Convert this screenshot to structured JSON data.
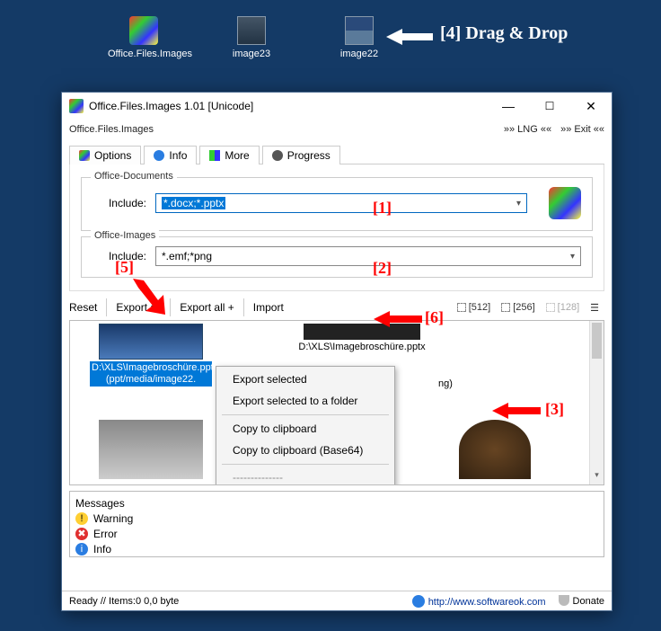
{
  "desktop": {
    "icons": [
      {
        "label": "Office.Files.Images"
      },
      {
        "label": "image23"
      },
      {
        "label": "image22"
      }
    ]
  },
  "annotations": {
    "dragdrop": "[4] Drag & Drop",
    "n1": "[1]",
    "n2": "[2]",
    "n3": "[3]",
    "n5": "[5]",
    "n6": "[6]"
  },
  "window": {
    "title": "Office.Files.Images 1.01 [Unicode]",
    "menubar": {
      "left": "Office.Files.Images",
      "lng": "»» LNG ««",
      "exit": "»» Exit ««"
    },
    "tabs": {
      "options": "Options",
      "info": "Info",
      "more": "More",
      "progress": "Progress"
    },
    "group_docs": {
      "legend": "Office-Documents",
      "label": "Include:",
      "value": "*.docx;*.pptx"
    },
    "group_imgs": {
      "legend": "Office-Images",
      "label": "Include:",
      "value": "*.emf;*png"
    },
    "toolbar": {
      "reset": "Reset",
      "export_all": "Export all",
      "export_all_plus": "Export all +",
      "import": "Import",
      "s512": "[512]",
      "s256": "[256]",
      "s128": "[128]"
    },
    "gallery": {
      "item1_line1": "D:\\XLS\\Imagebroschüre.pptx",
      "item1_line2": "(ppt/media/image22.",
      "item2_line1": "D:\\XLS\\Imagebroschüre.pptx",
      "item2_suffix": "ng)"
    },
    "context_menu": {
      "m1": "Export selected",
      "m2": "Export selected to a folder",
      "m3": "Copy to clipboard",
      "m4": "Copy to clipboard (Base64)",
      "dash": "--------------"
    },
    "messages": {
      "title": "Messages",
      "warning": "Warning",
      "error": "Error",
      "info": "Info"
    },
    "statusbar": {
      "left": "Ready // Items:0 0,0 byte",
      "url": "http://www.softwareok.com",
      "donate": "Donate"
    }
  }
}
